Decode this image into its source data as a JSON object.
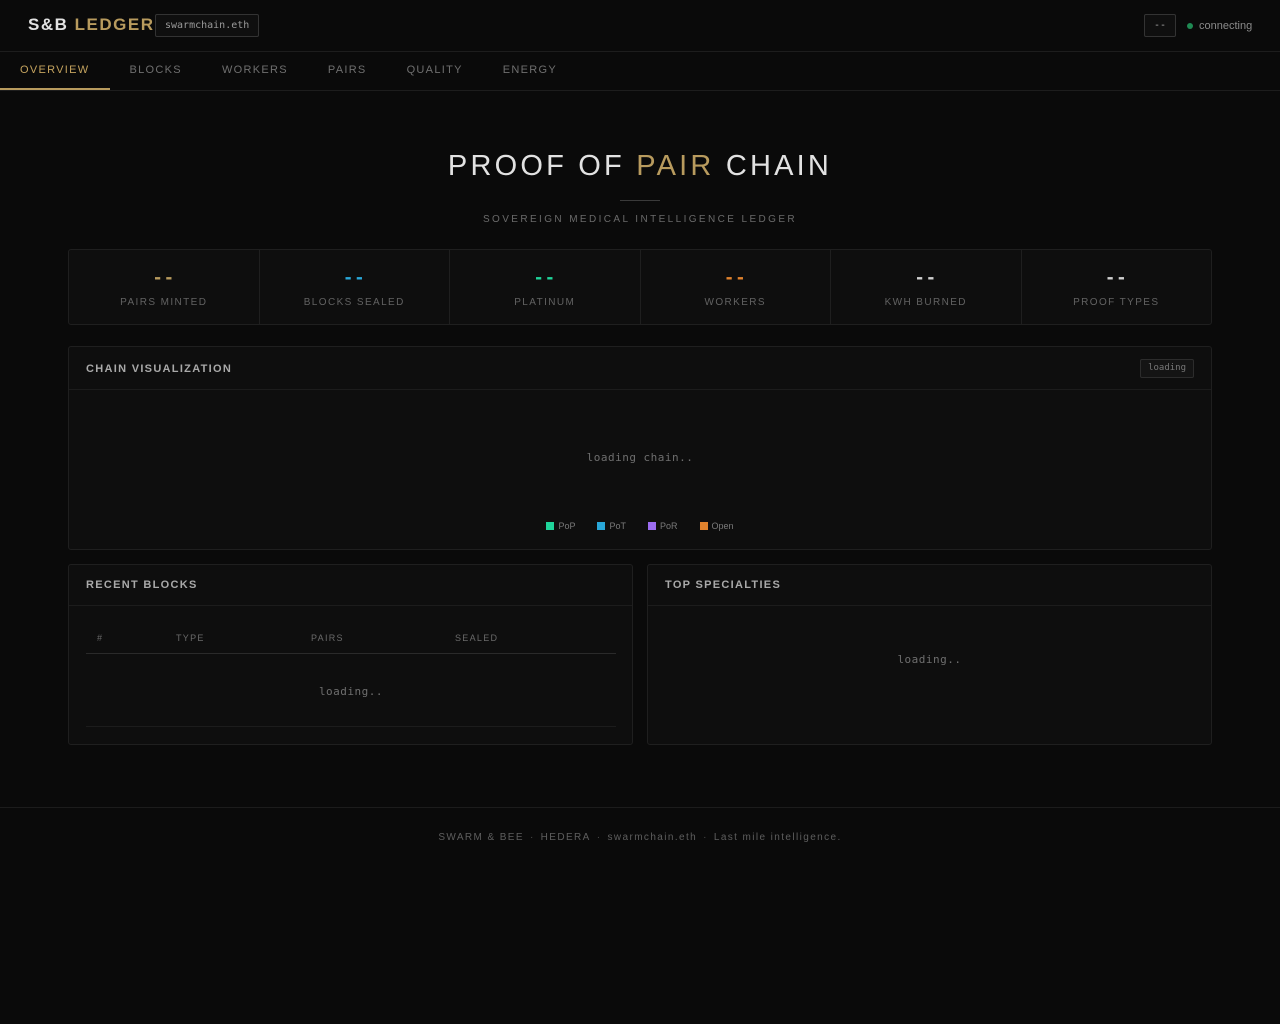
{
  "header": {
    "brand_part1": "S&B",
    "brand_part2": "LEDGER",
    "ens_badge": "swarmchain.eth",
    "dash_button": "--",
    "status": "connecting"
  },
  "nav": {
    "tabs": [
      {
        "label": "OVERVIEW",
        "active": true
      },
      {
        "label": "BLOCKS",
        "active": false
      },
      {
        "label": "WORKERS",
        "active": false
      },
      {
        "label": "PAIRS",
        "active": false
      },
      {
        "label": "QUALITY",
        "active": false
      },
      {
        "label": "ENERGY",
        "active": false
      }
    ]
  },
  "hero": {
    "title_part1": "PROOF OF",
    "title_accent": "PAIR",
    "title_part2": "CHAIN",
    "subtitle": "SOVEREIGN MEDICAL INTELLIGENCE LEDGER"
  },
  "stats": [
    {
      "value": "--",
      "label": "PAIRS MINTED",
      "color": "#b89b5e"
    },
    {
      "value": "--",
      "label": "BLOCKS SEALED",
      "color": "#29a7d8"
    },
    {
      "value": "--",
      "label": "PLATINUM",
      "color": "#1fd49a"
    },
    {
      "value": "--",
      "label": "WORKERS",
      "color": "#e0822d"
    },
    {
      "value": "--",
      "label": "KWH BURNED",
      "color": "#d0d0d0"
    },
    {
      "value": "--",
      "label": "PROOF TYPES",
      "color": "#d0d0d0"
    }
  ],
  "chain": {
    "title": "CHAIN VISUALIZATION",
    "badge": "loading",
    "loading_text": "loading chain..",
    "legend": [
      {
        "label": "PoP",
        "color": "#1fd49a"
      },
      {
        "label": "PoT",
        "color": "#29a7d8"
      },
      {
        "label": "PoR",
        "color": "#9b6cf0"
      },
      {
        "label": "Open",
        "color": "#e0822d"
      }
    ]
  },
  "recent_blocks": {
    "title": "RECENT BLOCKS",
    "columns": [
      "#",
      "TYPE",
      "PAIRS",
      "SEALED"
    ],
    "loading_text": "loading.."
  },
  "top_specialties": {
    "title": "TOP SPECIALTIES",
    "loading_text": "loading.."
  },
  "footer": {
    "items": [
      "SWARM & BEE",
      "HEDERA",
      "swarmchain.eth",
      "Last mile intelligence."
    ],
    "separator": "·"
  }
}
